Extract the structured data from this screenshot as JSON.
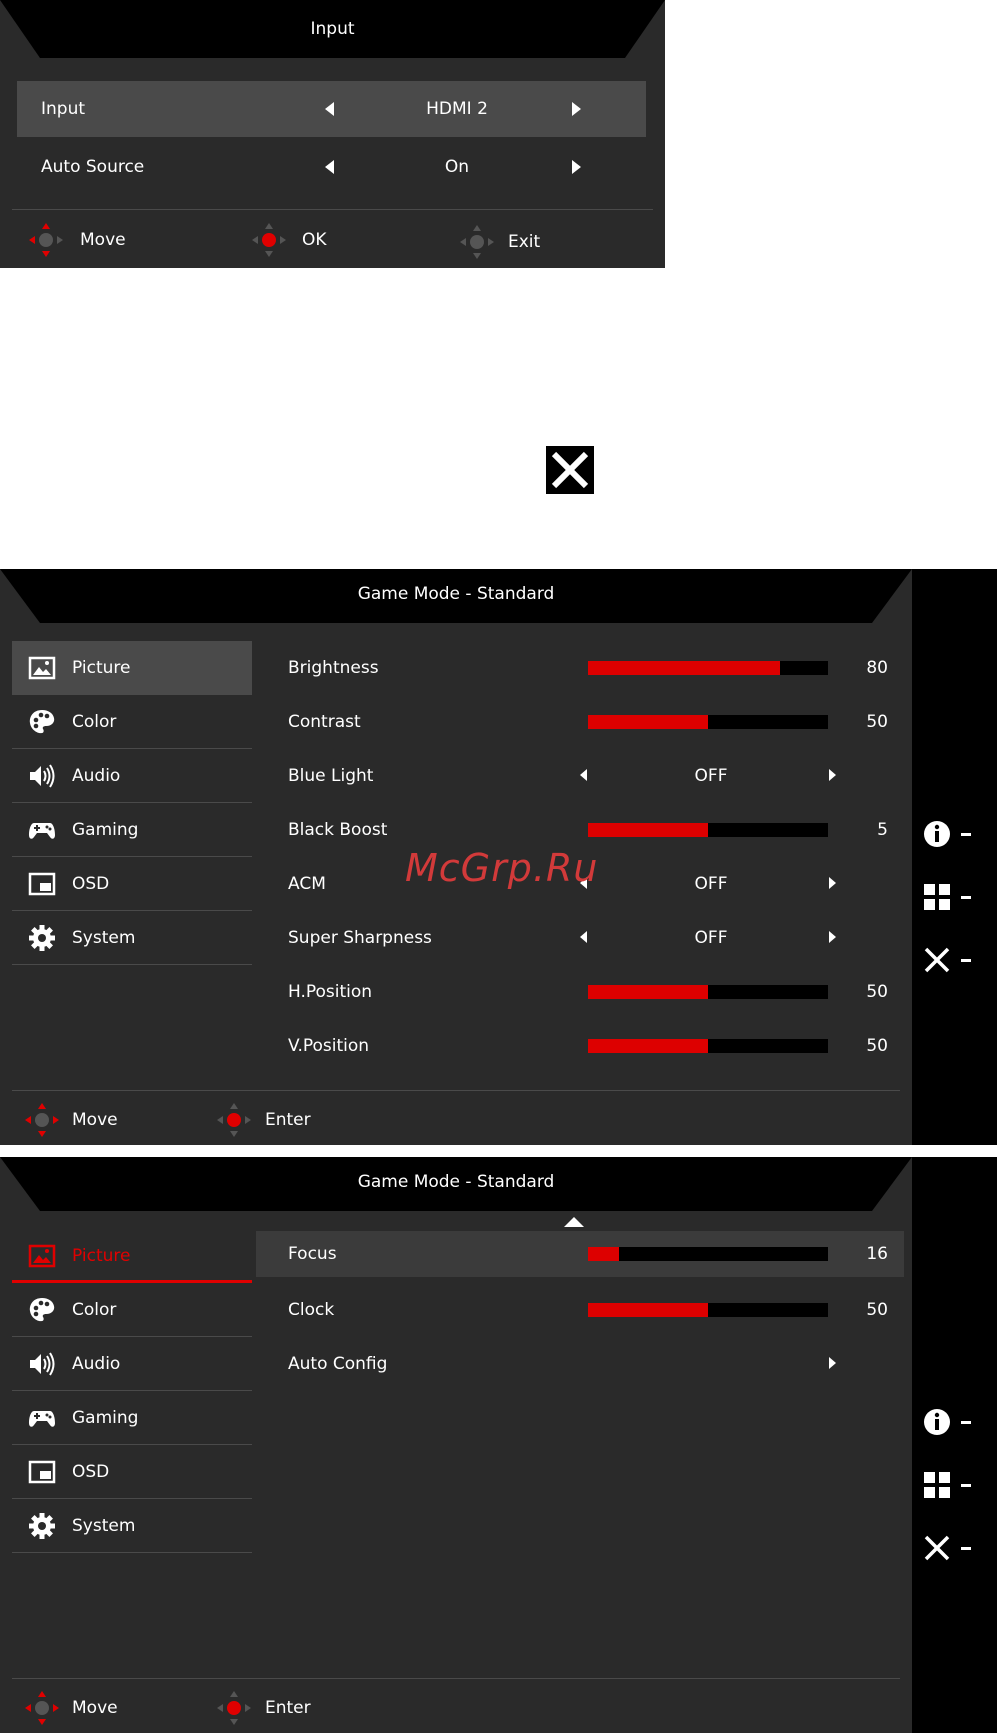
{
  "input_osd": {
    "title": "Input",
    "rows": [
      {
        "label": "Input",
        "value": "HDMI 2"
      },
      {
        "label": "Auto Source",
        "value": "On"
      }
    ],
    "hints": {
      "move": "Move",
      "ok": "OK",
      "exit": "Exit"
    }
  },
  "game_osd_1": {
    "title": "Game Mode - Standard",
    "nav": [
      "Picture",
      "Color",
      "Audio",
      "Gaming",
      "OSD",
      "System"
    ],
    "items": [
      {
        "label": "Brightness",
        "value": "80",
        "level": 0.8
      },
      {
        "label": "Contrast",
        "value": "50",
        "level": 0.5
      },
      {
        "label": "Blue Light",
        "option": "OFF"
      },
      {
        "label": "Black Boost",
        "value": "5",
        "level": 0.5
      },
      {
        "label": "ACM",
        "option": "OFF"
      },
      {
        "label": "Super Sharpness",
        "option": "OFF"
      },
      {
        "label": "H.Position",
        "value": "50",
        "level": 0.5
      },
      {
        "label": "V.Position",
        "value": "50",
        "level": 0.5
      }
    ],
    "hints": {
      "move": "Move",
      "enter": "Enter"
    }
  },
  "game_osd_2": {
    "title": "Game Mode - Standard",
    "nav": [
      "Picture",
      "Color",
      "Audio",
      "Gaming",
      "OSD",
      "System"
    ],
    "items": [
      {
        "label": "Focus",
        "value": "16",
        "level": 0.13
      },
      {
        "label": "Clock",
        "value": "50",
        "level": 0.5
      },
      {
        "label": "Auto Config"
      }
    ],
    "hints": {
      "move": "Move",
      "enter": "Enter"
    }
  },
  "watermark": "McGrp.Ru",
  "colors": {
    "accent": "#dd0000",
    "panel": "#2a2a2a",
    "selected": "#4a4a4a",
    "side": "#000000"
  }
}
